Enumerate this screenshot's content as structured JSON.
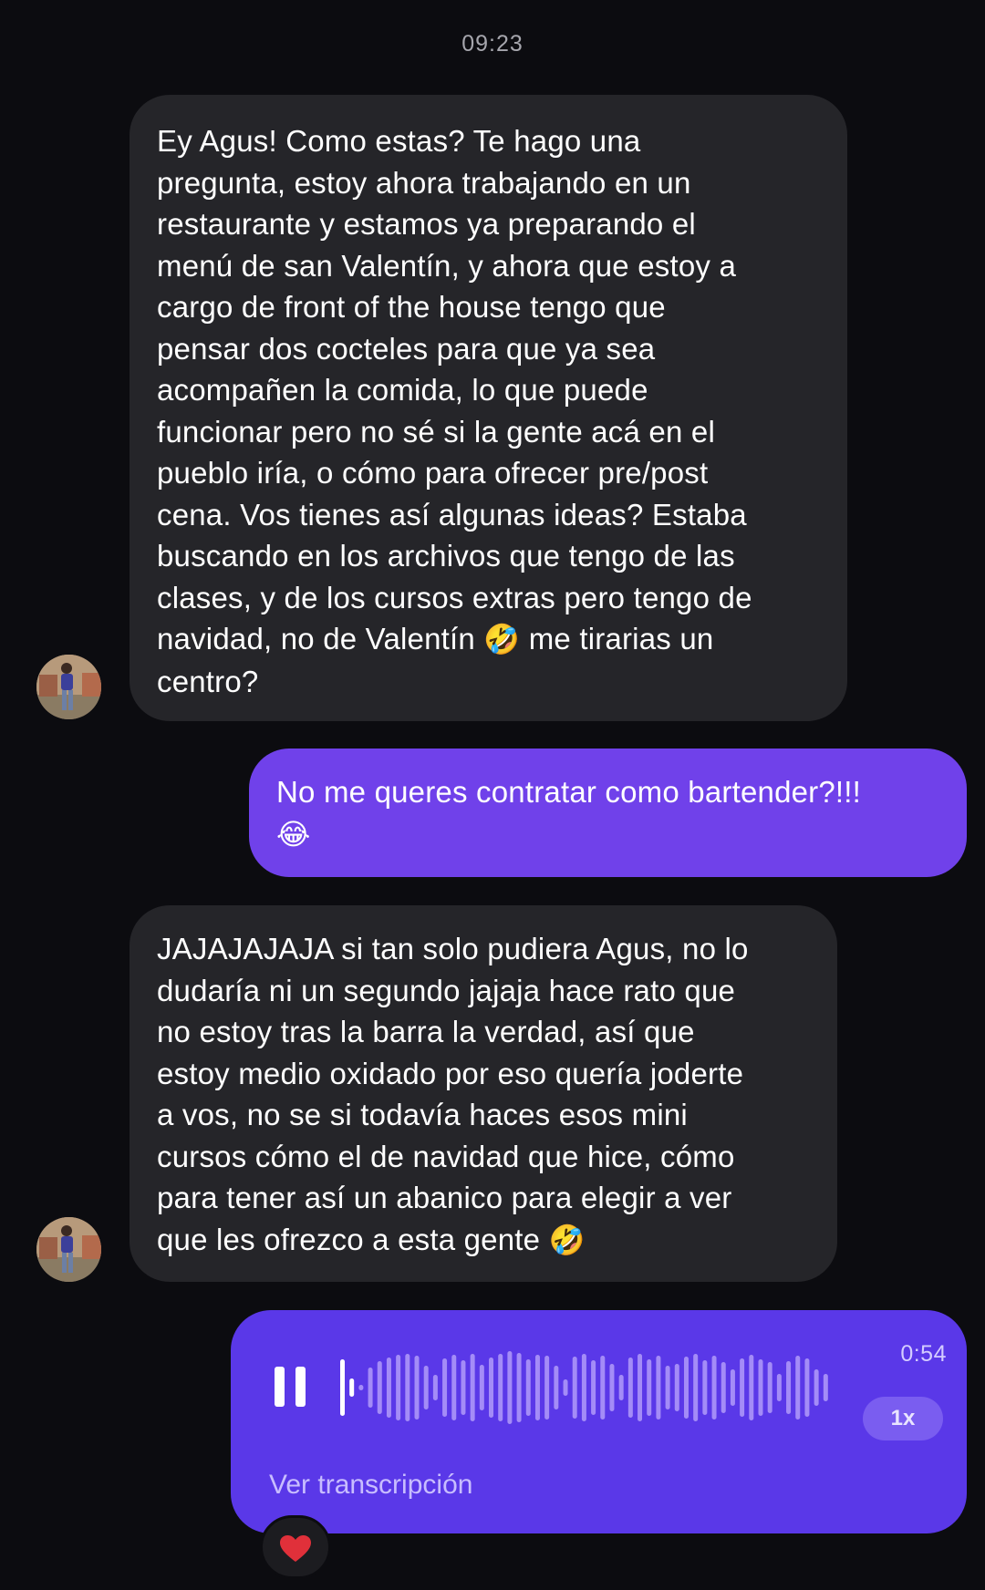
{
  "chat": {
    "timestamp": "09:23",
    "messages": [
      {
        "direction": "incoming",
        "text": "Ey Agus! Como estas? Te hago una\npregunta, estoy ahora trabajando en un\nrestaurante y estamos ya preparando el\nmenú de san Valentín, y ahora que estoy a\ncargo de front of the house tengo que\npensar dos cocteles para que ya sea\nacompañen la comida, lo que puede\nfuncionar pero no sé si la gente acá en el\npueblo iría, o cómo para ofrecer pre/post\ncena. Vos tienes así algunas ideas? Estaba\nbuscando en los archivos que tengo de las\nclases, y de los cursos extras pero tengo de\nnavidad, no de Valentín",
        "emoji": "🤣",
        "text_after": " me tirarias un\ncentro?"
      },
      {
        "direction": "outgoing",
        "text": "No me queres contratar como bartender?!!!\n",
        "emoji": "😂"
      },
      {
        "direction": "incoming",
        "text": "JAJAJAJAJA si tan solo pudiera Agus, no lo\ndudaría ni un segundo jajaja hace rato que\nno estoy tras la barra la verdad, así que\nestoy medio oxidado por eso quería joderte\na vos, no se si todavía haces esos mini\ncursos cómo el de navidad que hice, cómo\npara tener así un abanico para elegir a ver\nque les ofrezco a esta gente ",
        "emoji": "🤣"
      }
    ],
    "voice_message": {
      "direction": "outgoing",
      "duration": "0:54",
      "speed": "1x",
      "transcript_link": "Ver transcripción",
      "playback_state": "playing",
      "progress": 0.02,
      "reaction": "heart",
      "reaction_color": "#e0303a"
    },
    "colors": {
      "background": "#0c0c10",
      "incoming_bubble": "#252529",
      "outgoing_bubble": "#7041ea",
      "voice_bubble": "#5a38e8"
    }
  }
}
